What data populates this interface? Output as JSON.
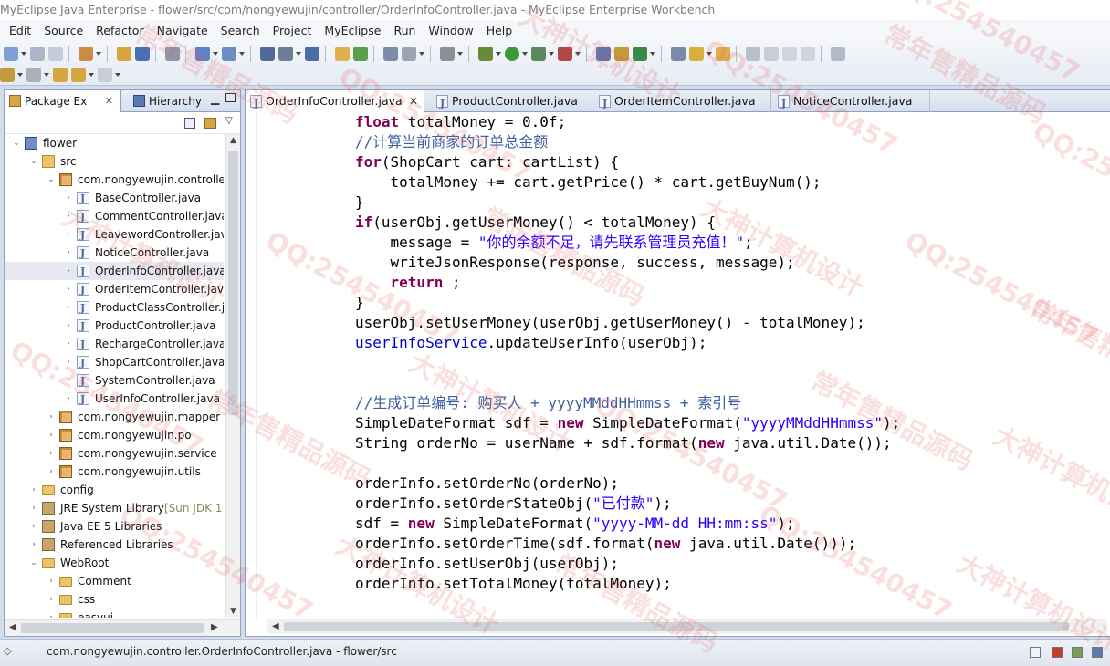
{
  "window": {
    "title": "MyEclipse Java Enterprise - flower/src/com/nongyewujin/controller/OrderInfoController.java - MyEclipse Enterprise Workbench"
  },
  "menubar": {
    "items": [
      "Edit",
      "Source",
      "Refactor",
      "Navigate",
      "Search",
      "Project",
      "MyEclipse",
      "Run",
      "Window",
      "Help"
    ]
  },
  "left_panel": {
    "tabs": [
      {
        "label": "Package Ex",
        "close": "✕",
        "active": true
      },
      {
        "label": "Hierarchy",
        "active": false
      }
    ],
    "tree": [
      {
        "label": "flower",
        "icon": "project-icon",
        "expanded": true
      },
      {
        "label": "src",
        "icon": "source-folder-icon",
        "expanded": true
      },
      {
        "label": "com.nongyewujin.controller",
        "icon": "package-icon",
        "expanded": true
      },
      {
        "label": "BaseController.java",
        "icon": "java-file-icon"
      },
      {
        "label": "CommentController.java",
        "icon": "java-file-icon"
      },
      {
        "label": "LeavewordController.java",
        "icon": "java-file-icon"
      },
      {
        "label": "NoticeController.java",
        "icon": "java-file-icon"
      },
      {
        "label": "OrderInfoController.java",
        "icon": "java-file-icon",
        "selected": true
      },
      {
        "label": "OrderItemController.java",
        "icon": "java-file-icon"
      },
      {
        "label": "ProductClassController.java",
        "icon": "java-file-icon"
      },
      {
        "label": "ProductController.java",
        "icon": "java-file-icon"
      },
      {
        "label": "RechargeController.java",
        "icon": "java-file-icon"
      },
      {
        "label": "ShopCartController.java",
        "icon": "java-file-icon"
      },
      {
        "label": "SystemController.java",
        "icon": "java-file-icon"
      },
      {
        "label": "UserInfoController.java",
        "icon": "java-file-icon"
      },
      {
        "label": "com.nongyewujin.mapper",
        "icon": "package-icon"
      },
      {
        "label": "com.nongyewujin.po",
        "icon": "package-icon"
      },
      {
        "label": "com.nongyewujin.service",
        "icon": "package-icon"
      },
      {
        "label": "com.nongyewujin.utils",
        "icon": "package-icon"
      },
      {
        "label": "config",
        "icon": "folder-icon"
      },
      {
        "label": "JRE System Library",
        "suffix": "[Sun JDK 1",
        "icon": "library-icon"
      },
      {
        "label": "Java EE 5 Libraries",
        "icon": "library-icon"
      },
      {
        "label": "Referenced Libraries",
        "icon": "library-icon"
      },
      {
        "label": "WebRoot",
        "icon": "folder-icon",
        "expanded": true
      },
      {
        "label": "Comment",
        "icon": "folder-icon"
      },
      {
        "label": "css",
        "icon": "folder-icon"
      },
      {
        "label": "easyui",
        "icon": "folder-icon"
      }
    ]
  },
  "editor": {
    "tabs": [
      {
        "label": "OrderInfoController.java",
        "close": "✕",
        "active": true
      },
      {
        "label": "ProductController.java",
        "active": false
      },
      {
        "label": "OrderItemController.java",
        "active": false
      },
      {
        "label": "NoticeController.java",
        "active": false
      }
    ],
    "code_lines": [
      "float totalMoney = 0.0f;",
      "//计算当前商家的订单总金额",
      "for(ShopCart cart: cartList) {",
      "    totalMoney += cart.getPrice() * cart.getBuyNum();",
      "}",
      "if(userObj.getUserMoney() < totalMoney) {",
      "    message = \"你的余额不足，请先联系管理员充值！\";",
      "    writeJsonResponse(response, success, message);",
      "    return ;",
      "}",
      "userObj.setUserMoney(userObj.getUserMoney() - totalMoney);",
      "userInfoService.updateUserInfo(userObj);",
      "",
      "",
      "//生成订单编号: 购买人 + yyyyMMddHHmmss + 索引号",
      "SimpleDateFormat sdf = new SimpleDateFormat(\"yyyyMMddHHmmss\");",
      "String orderNo = userName + sdf.format(new java.util.Date());",
      "",
      "orderInfo.setOrderNo(orderNo);",
      "orderInfo.setOrderStateObj(\"已付款\");",
      "sdf = new SimpleDateFormat(\"yyyy-MM-dd HH:mm:ss\");",
      "orderInfo.setOrderTime(sdf.format(new java.util.Date()));",
      "orderInfo.setUserObj(userObj);",
      "orderInfo.setTotalMoney(totalMoney);"
    ]
  },
  "statusbar": {
    "text": "com.nongyewujin.controller.OrderInfoController.java - flower/src"
  },
  "watermark": {
    "texts": [
      "QQ:254540457",
      "常年售精品源码",
      "大神计算机设计"
    ]
  },
  "colors": {
    "keyword": "#7f0055",
    "comment": "#3f5f9f",
    "string": "#2a00ff",
    "field": "#0000c0",
    "selection": "#e6e9ef"
  }
}
